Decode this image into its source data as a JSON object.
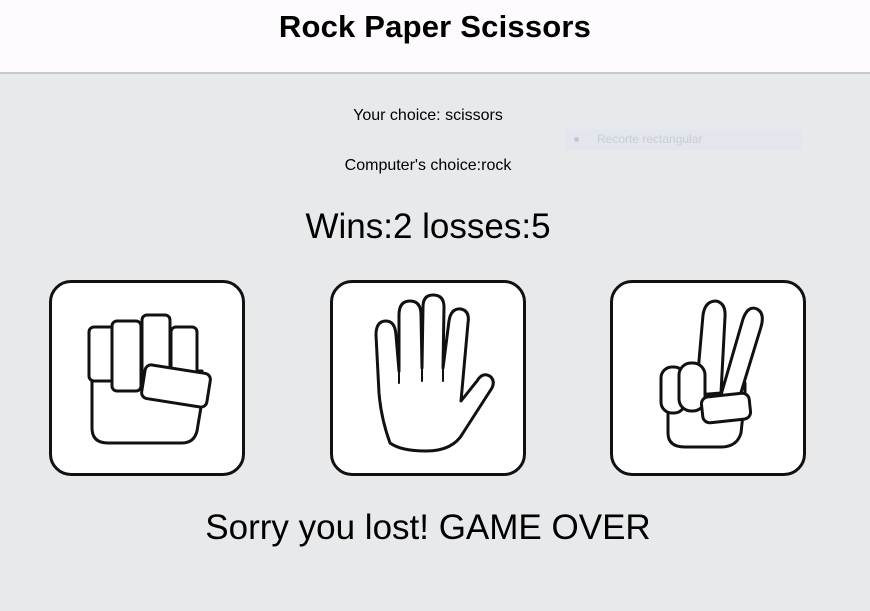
{
  "header": {
    "title": "Rock Paper Scissors"
  },
  "status": {
    "your_choice_label": "Your choice: ",
    "your_choice_value": "scissors",
    "computer_choice_label": "Computer's choice:",
    "computer_choice_value": "rock"
  },
  "score": {
    "wins_label": "Wins:",
    "wins": "2",
    "losses_label": "losses:",
    "losses": "5"
  },
  "choices": [
    {
      "name": "rock",
      "icon": "fist-icon"
    },
    {
      "name": "paper",
      "icon": "open-hand-icon"
    },
    {
      "name": "scissors",
      "icon": "peace-sign-icon"
    }
  ],
  "result": {
    "message": "Sorry you lost! GAME OVER"
  },
  "overlay": {
    "label": "Recorte rectangular"
  },
  "colors": {
    "page_background": "#e8e9eb",
    "header_background": "#fdfbfd",
    "card_border": "#111111"
  }
}
